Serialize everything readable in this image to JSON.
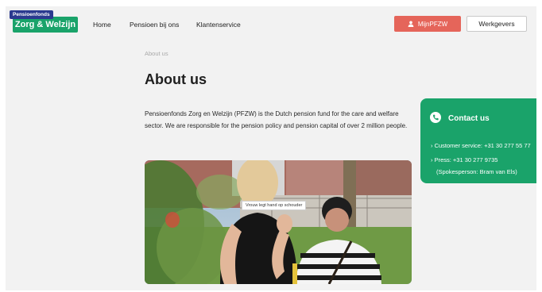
{
  "logo": {
    "top_text": "Pensioenfonds",
    "main_text": "Zorg & Welzijn"
  },
  "nav": {
    "home": "Home",
    "pensioen": "Pensioen bij ons",
    "klantenservice": "Klantenservice"
  },
  "header_buttons": {
    "mijn": "MijnPFZW",
    "werkgevers": "Werkgevers"
  },
  "breadcrumb": "About us",
  "title": "About us",
  "intro": "Pensioenfonds Zorg en Welzijn (PFZW) is the Dutch pension fund for the care and welfare sector. We are responsible for the pension policy and pension capital of over 2 million people.",
  "image": {
    "tooltip": "Vrouw legt hand op schouder"
  },
  "contact": {
    "title": "Contact us",
    "customer": "› Customer service: +31 30 277 55 77",
    "press": "› Press: +31 30 277 9735",
    "spokesperson": "(Spokesperson: Bram van Els)"
  },
  "colors": {
    "green": "#1aa36a",
    "coral": "#e5655a",
    "navy": "#2b3a8f"
  },
  "icons": {
    "mijn": "user-icon",
    "contact": "phone-icon"
  }
}
